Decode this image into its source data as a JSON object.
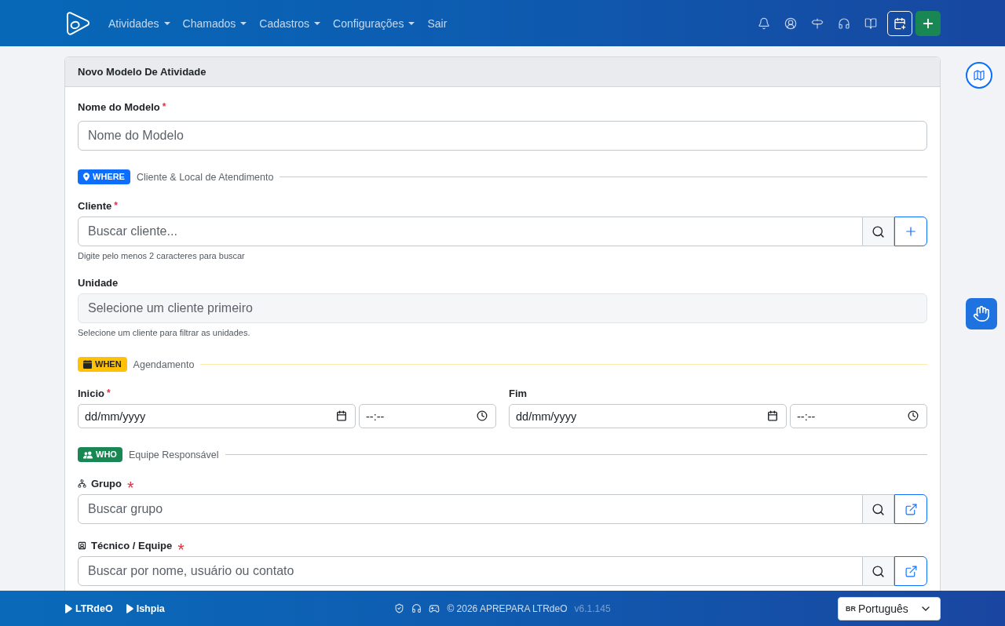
{
  "navbar": {
    "menu": [
      {
        "label": "Atividades",
        "dropdown": true
      },
      {
        "label": "Chamados",
        "dropdown": true
      },
      {
        "label": "Cadastros",
        "dropdown": true
      },
      {
        "label": "Configurações",
        "dropdown": true
      },
      {
        "label": "Sair",
        "dropdown": false
      }
    ]
  },
  "form": {
    "title": "Novo Modelo De Atividade",
    "fields": [
      {
        "kind": "text",
        "label": "Nome do Modelo",
        "required_mark": "*",
        "placeholder": "Nome do Modelo"
      }
    ],
    "sections": [
      {
        "tag": "WHERE",
        "color": "#0d6efd",
        "title": "Cliente & Local de Atendimento",
        "fields": [
          {
            "kind": "search",
            "label": "Cliente",
            "required_mark": "*",
            "placeholder": "Buscar cliente...",
            "help": "Digite pelo menos 2 caracteres para buscar"
          },
          {
            "kind": "select",
            "label": "Unidade",
            "placeholder": "Selecione um cliente primeiro",
            "disabled": true,
            "help": "Selecione um cliente para filtrar as unidades."
          }
        ]
      },
      {
        "tag": "WHEN",
        "color": "#ffc107",
        "title": "Agendamento",
        "fields": [
          {
            "kind": "datetime",
            "label": "Inicio",
            "required_mark": "*",
            "date_placeholder": "dd/mm/yyyy",
            "time_placeholder": "--:--"
          },
          {
            "kind": "datetime",
            "label": "Fim",
            "date_placeholder": "dd/mm/yyyy",
            "time_placeholder": "--:--"
          }
        ]
      },
      {
        "tag": "WHO",
        "color": "#198754",
        "title": "Equipe Responsável",
        "fields": [
          {
            "kind": "lookup",
            "label": "Grupo",
            "required_mark": "*",
            "placeholder": "Buscar grupo"
          },
          {
            "kind": "lookup",
            "label": "Técnico / Equipe",
            "required_mark": "*",
            "placeholder": "Buscar por nome, usuário ou contato"
          }
        ]
      }
    ]
  },
  "footer": {
    "links": [
      "LTRdeO",
      "Ishpia"
    ],
    "copyright": "© 2026 APREPARA LTRdeO",
    "version": "v6.1.145",
    "language": {
      "flag": "BR",
      "label": "Português"
    }
  }
}
